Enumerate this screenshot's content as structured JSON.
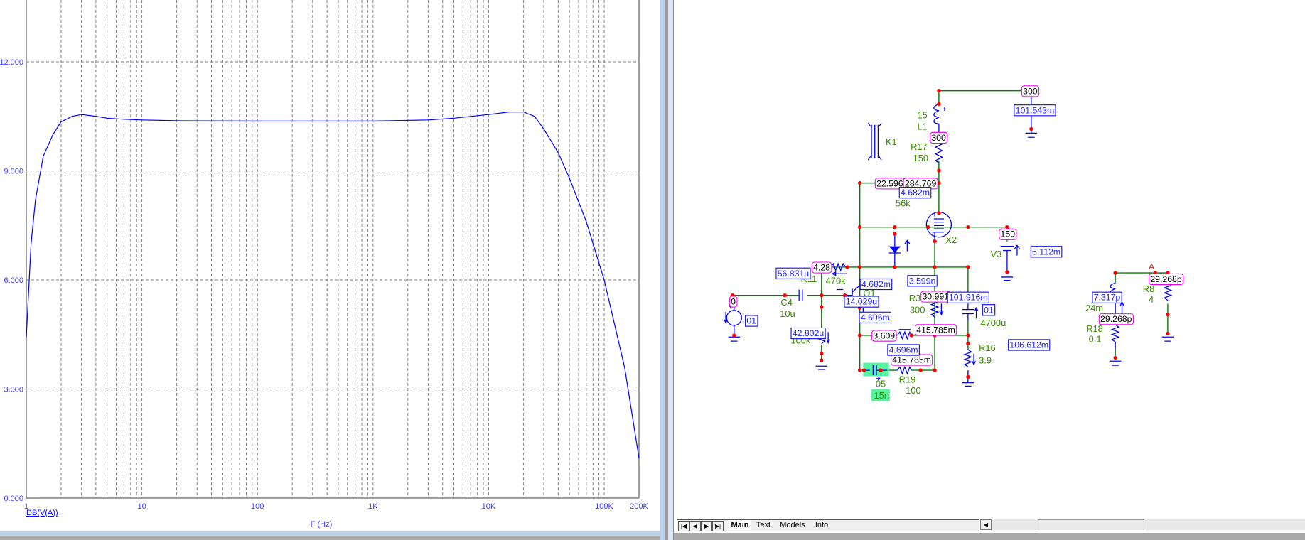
{
  "chart_data": {
    "type": "line",
    "title": "",
    "xlabel": "F (Hz)",
    "ylabel": "DB(V(A))",
    "xscale": "log",
    "xlim": [
      1,
      200000
    ],
    "ylim": [
      0,
      13.7
    ],
    "grid": true,
    "x_tick_labels": [
      "1",
      "10",
      "100",
      "1K",
      "10K",
      "100K",
      "200K"
    ],
    "y_tick_labels": [
      "0.000",
      "3.000",
      "6.000",
      "9.000",
      "12.000"
    ],
    "series": [
      {
        "name": "DB(V(A))",
        "color": "#0000ff",
        "x": [
          1,
          1.1,
          1.2,
          1.4,
          1.7,
          2,
          2.5,
          3,
          4,
          5,
          7,
          10,
          20,
          100,
          1000,
          3000,
          5000,
          10000,
          15000,
          20000,
          25000,
          30000,
          40000,
          50000,
          70000,
          100000,
          150000,
          200000
        ],
        "y": [
          4.43,
          7.0,
          8.2,
          9.4,
          10.0,
          10.35,
          10.5,
          10.55,
          10.5,
          10.45,
          10.42,
          10.4,
          10.38,
          10.37,
          10.37,
          10.4,
          10.45,
          10.55,
          10.62,
          10.62,
          10.5,
          10.15,
          9.5,
          8.8,
          7.6,
          6.0,
          3.6,
          1.1
        ]
      }
    ]
  },
  "circuit": {
    "labels": {
      "L1_val": "15",
      "L1": "L1",
      "K1": "K1",
      "R17": "R17",
      "R17_val": "150",
      "R_56k": "56k",
      "X2": "X2",
      "V3": "V3",
      "R11": "R11",
      "R_470k": "470k",
      "C4": "C4",
      "C4_val": "10u",
      "R_100k": "100k",
      "Q1": "Q1",
      "R3": "R3",
      "R3_val": "300",
      "C_4700u": "4700u",
      "R16": "R16",
      "R16_val": "3.9",
      "C5": "05",
      "C5_val": "15n",
      "R19": "R19",
      "R19_val": "100",
      "node_A": "A",
      "L_24m": "24m",
      "R8": "R8",
      "R8_val": "4",
      "R18": "R18",
      "R18_val": "0.1",
      "plus": "+"
    },
    "voltages": [
      "300",
      "300",
      "22.596",
      "284.769",
      "150",
      "4.28",
      "0",
      "30.991",
      "3.609",
      "415.785m",
      "415.785m",
      "29.268p",
      "29.268p"
    ],
    "currents": [
      "101.543m",
      "4.682m",
      "5.112m",
      "56.831u",
      "3.599n",
      "4.682m",
      "14.029u",
      "101.916m",
      "4.696m",
      "42.802u",
      "106.612m",
      "4.696m",
      "7.317p",
      "01",
      "01"
    ]
  },
  "tabs": {
    "items": [
      "Main",
      "Text",
      "Models",
      "Info"
    ],
    "active": "Main"
  }
}
